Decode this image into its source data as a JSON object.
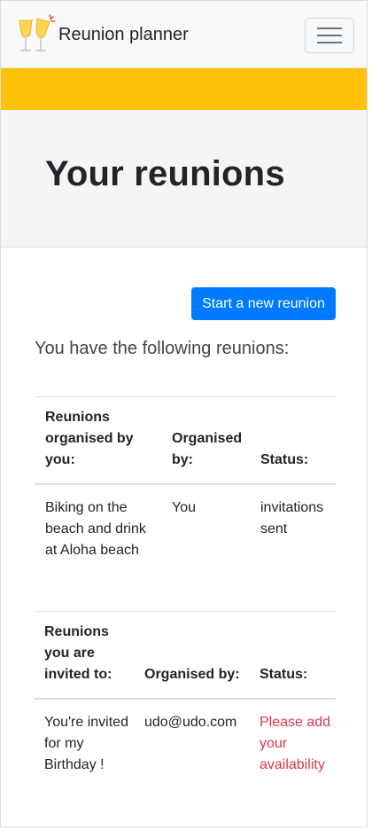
{
  "navbar": {
    "brand": "Reunion planner",
    "logo_icon": "champagne-glasses-icon",
    "toggler_icon": "hamburger-menu-icon"
  },
  "colors": {
    "primary": "#007bff",
    "warning_bar": "#ffc107",
    "danger_text": "#dc3545"
  },
  "jumbotron": {
    "title": "Your reunions"
  },
  "main": {
    "new_reunion_button": "Start a new reunion",
    "intro": "You have the following reunions:",
    "organised_table": {
      "headers": [
        "Reunions organised by you:",
        "Organised by:",
        "Status:"
      ],
      "rows": [
        {
          "name": "Biking on the beach and drink at Aloha beach",
          "organiser": "You",
          "status": "invitations sent"
        }
      ]
    },
    "invited_table": {
      "headers": [
        "Reunions you are invited to:",
        "Organised by:",
        "Status:"
      ],
      "rows": [
        {
          "name": "You're invited for my Birthday !",
          "organiser": "udo@udo.com",
          "status": "Please add your availability"
        }
      ]
    }
  }
}
